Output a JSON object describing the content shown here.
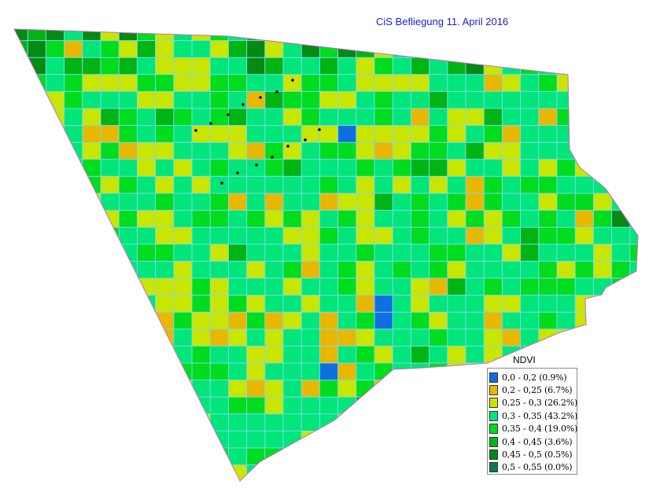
{
  "title": "CiS Befliegung  11. April 2016",
  "legend": {
    "title": "NDVI",
    "items": [
      {
        "label": "0,0 - 0,2    (0.9%)",
        "color": "#0f6fe0",
        "share": 0.9
      },
      {
        "label": "0,2 - 0,25  (6.7%)",
        "color": "#e8b800",
        "share": 6.7
      },
      {
        "label": "0,25 - 0,3  (26.2%)",
        "color": "#c9e600",
        "share": 26.2
      },
      {
        "label": "0,3 - 0,35  (43.2%)",
        "color": "#00e67a",
        "share": 43.2
      },
      {
        "label": "0,35 - 0,4  (19.0%)",
        "color": "#00dc1e",
        "share": 19.0
      },
      {
        "label": "0,4 - 0,45  (3.6%)",
        "color": "#00b414",
        "share": 3.6
      },
      {
        "label": "0,45 - 0,5  (0.5%)",
        "color": "#058a12",
        "share": 0.5
      },
      {
        "label": "0,5 - 0,55  (0.0%)",
        "color": "#0a7a50",
        "share": 0.0
      }
    ]
  },
  "map_style": {
    "grid_line_color": "#7dd8ee",
    "field_outline_color": "#c070c0",
    "track_point_color": "#000000"
  }
}
